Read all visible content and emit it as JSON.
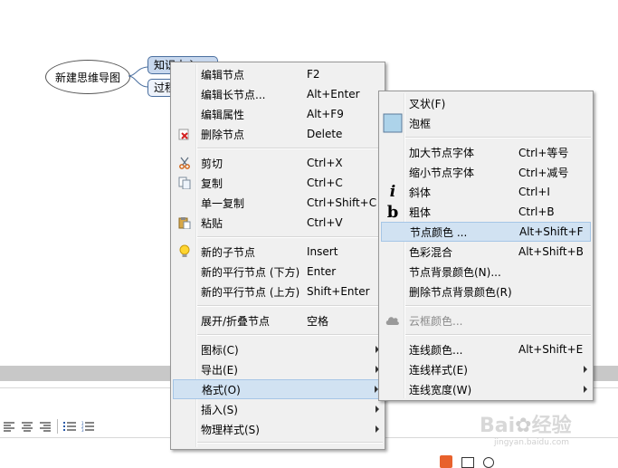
{
  "mindmap": {
    "root": "新建思维导图",
    "child1": "知识中心",
    "child2": "过程"
  },
  "context_menu": {
    "items": [
      {
        "label": "编辑节点",
        "key": "F2"
      },
      {
        "label": "编辑长节点...",
        "key": "Alt+Enter"
      },
      {
        "label": "编辑属性",
        "key": "Alt+F9"
      },
      {
        "label": "删除节点",
        "key": "Delete"
      },
      {
        "label": "剪切",
        "key": "Ctrl+X"
      },
      {
        "label": "复制",
        "key": "Ctrl+C"
      },
      {
        "label": "单一复制",
        "key": "Ctrl+Shift+C"
      },
      {
        "label": "粘贴",
        "key": "Ctrl+V"
      },
      {
        "label": "新的子节点",
        "key": "Insert"
      },
      {
        "label": "新的平行节点 (下方)",
        "key": "Enter"
      },
      {
        "label": "新的平行节点 (上方)",
        "key": "Shift+Enter"
      },
      {
        "label": "展开/折叠节点",
        "key": "空格"
      },
      {
        "label": "图标(C)"
      },
      {
        "label": "导出(E)"
      },
      {
        "label": "格式(O)"
      },
      {
        "label": "插入(S)"
      },
      {
        "label": "物理样式(S)"
      }
    ]
  },
  "format_menu": {
    "items": [
      {
        "label": "叉状(F)"
      },
      {
        "label": "泡框"
      },
      {
        "label": "加大节点字体",
        "key": "Ctrl+等号"
      },
      {
        "label": "缩小节点字体",
        "key": "Ctrl+减号"
      },
      {
        "label": "斜体",
        "key": "Ctrl+I"
      },
      {
        "label": "粗体",
        "key": "Ctrl+B"
      },
      {
        "label": "节点颜色 ...",
        "key": "Alt+Shift+F"
      },
      {
        "label": "色彩混合",
        "key": "Alt+Shift+B"
      },
      {
        "label": "节点背景颜色(N)..."
      },
      {
        "label": "删除节点背景颜色(R)"
      },
      {
        "label": "云框颜色..."
      },
      {
        "label": "连线颜色...",
        "key": "Alt+Shift+E"
      },
      {
        "label": "连线样式(E)"
      },
      {
        "label": "连线宽度(W)"
      }
    ]
  },
  "icons": {
    "italic_glyph": "i",
    "bold_glyph": "b"
  },
  "colors": {
    "highlight": "#d1e2f2",
    "bubble_swatch": "#add3ea"
  },
  "watermark": {
    "brand": "Bai",
    "brand2": "经验",
    "url": "jingyan.baidu.com"
  }
}
